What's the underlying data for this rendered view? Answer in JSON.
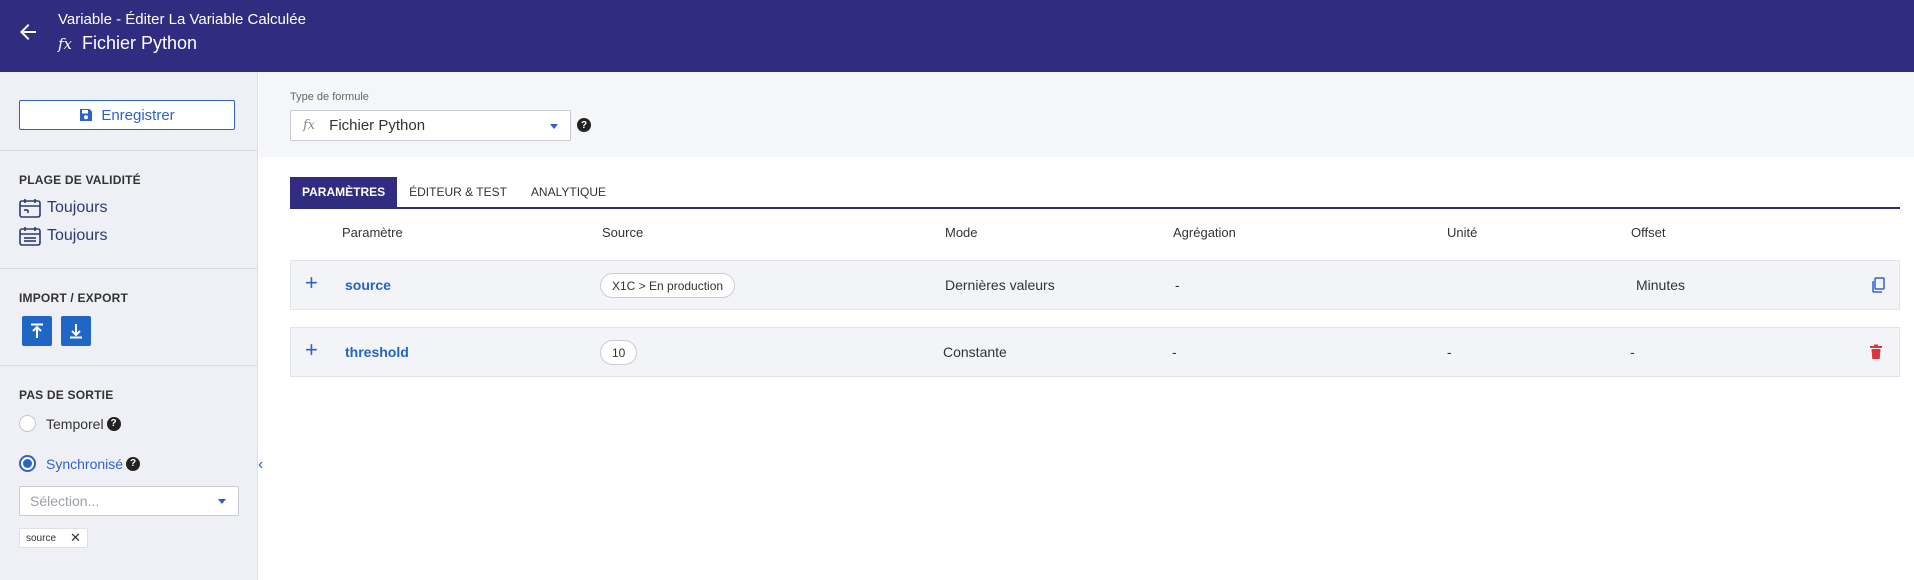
{
  "header": {
    "subtitle": "Variable - Éditer La Variable Calculée",
    "title": "Fichier Python"
  },
  "sidebar": {
    "save_label": "Enregistrer",
    "validity": {
      "title": "PLAGE DE VALIDITÉ",
      "start": "Toujours",
      "end": "Toujours"
    },
    "import_export": {
      "title": "IMPORT / EXPORT"
    },
    "output_step": {
      "title": "PAS DE SORTIE",
      "temporal_label": "Temporel",
      "synchronized_label": "Synchronisé",
      "selected": "synchronized",
      "select_placeholder": "Sélection...",
      "chips": [
        "source"
      ]
    }
  },
  "formula": {
    "label": "Type de formule",
    "value": "Fichier Python"
  },
  "tabs": [
    {
      "label": "PARAMÈTRES",
      "active": true
    },
    {
      "label": "ÉDITEUR & TEST",
      "active": false
    },
    {
      "label": "ANALYTIQUE",
      "active": false
    }
  ],
  "table": {
    "headers": [
      "Paramètre",
      "Source",
      "Mode",
      "Agrégation",
      "Unité",
      "Offset"
    ],
    "rows": [
      {
        "name": "source",
        "source": "X1C > En production",
        "mode": "Dernières valeurs",
        "aggregation": "-",
        "unit": "",
        "offset": "Minutes",
        "action": "copy-icon"
      },
      {
        "name": "threshold",
        "source": "10",
        "mode": "Constante",
        "aggregation": "-",
        "unit": "-",
        "offset": "-",
        "action": "trash-icon"
      }
    ]
  },
  "colors": {
    "header_bg": "#302c80",
    "accent": "#2f62c9",
    "delete": "#d9363e"
  }
}
